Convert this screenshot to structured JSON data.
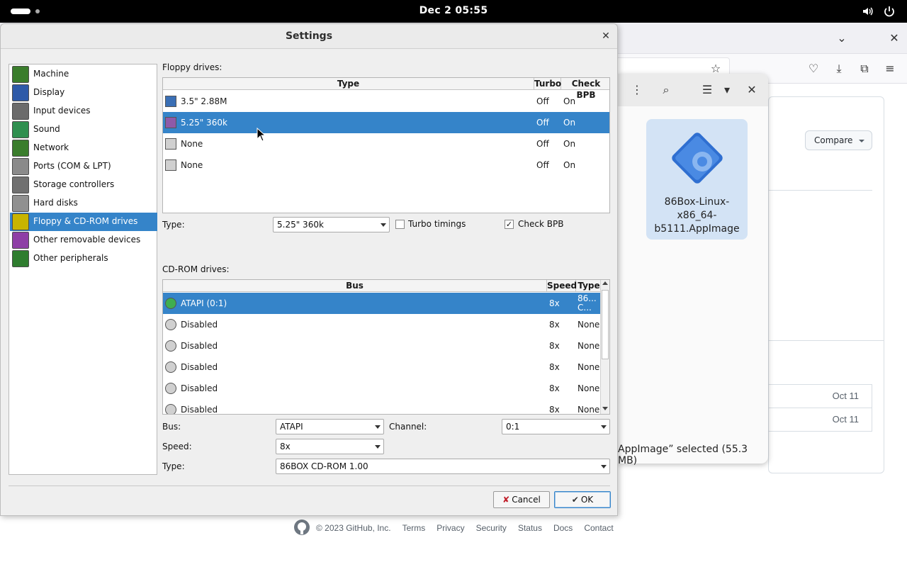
{
  "topbar": {
    "clock": "Dec 2  05:55"
  },
  "browser": {
    "compare_label": "Compare",
    "dates": [
      "Oct 11",
      "Oct 11"
    ],
    "footer": {
      "copyright": "© 2023 GitHub, Inc.",
      "links": [
        "Terms",
        "Privacy",
        "Security",
        "Status",
        "Docs",
        "Contact"
      ]
    }
  },
  "files": {
    "file_name_lines": [
      "86Box-Linux-",
      "x86_64-",
      "b5111.AppImage"
    ],
    "status": "AppImage” selected  (55.3 MB)"
  },
  "dialog": {
    "title": "Settings",
    "categories": [
      {
        "label": "Machine",
        "color": "#3a7d2c"
      },
      {
        "label": "Display",
        "color": "#2e5aa8"
      },
      {
        "label": "Input devices",
        "color": "#6b6b6b"
      },
      {
        "label": "Sound",
        "color": "#2f8f4f"
      },
      {
        "label": "Network",
        "color": "#3a7d2c"
      },
      {
        "label": "Ports (COM & LPT)",
        "color": "#8a8a8a"
      },
      {
        "label": "Storage controllers",
        "color": "#707070"
      },
      {
        "label": "Hard disks",
        "color": "#909090"
      },
      {
        "label": "Floppy & CD-ROM drives",
        "color": "#c8b400"
      },
      {
        "label": "Other removable devices",
        "color": "#8e3fa6"
      },
      {
        "label": "Other peripherals",
        "color": "#2f7d2f"
      }
    ],
    "selected_category": 8,
    "floppy": {
      "section_label": "Floppy drives:",
      "headers": {
        "type": "Type",
        "turbo": "Turbo",
        "check_bpb": "Check BPB"
      },
      "rows": [
        {
          "type": "3.5\" 2.88M",
          "turbo": "Off",
          "check_bpb": "On",
          "icon": "floppy-35-icon"
        },
        {
          "type": "5.25\" 360k",
          "turbo": "Off",
          "check_bpb": "On",
          "icon": "floppy-525-icon"
        },
        {
          "type": "None",
          "turbo": "Off",
          "check_bpb": "On",
          "icon": "floppy-none-icon"
        },
        {
          "type": "None",
          "turbo": "Off",
          "check_bpb": "On",
          "icon": "floppy-none-icon"
        }
      ],
      "selected_row": 1,
      "type_label": "Type:",
      "type_value": "5.25\" 360k",
      "turbo_label": "Turbo timings",
      "turbo_checked": false,
      "checkbpb_label": "Check BPB",
      "checkbpb_checked": true,
      "check_mark": "✓"
    },
    "cdrom": {
      "section_label": "CD-ROM drives:",
      "headers": {
        "bus": "Bus",
        "speed": "Speed",
        "type": "Type"
      },
      "rows": [
        {
          "bus": "ATAPI (0:1)",
          "speed": "8x",
          "type_line1": "86...",
          "type_line2": "C..."
        },
        {
          "bus": "Disabled",
          "speed": "8x",
          "type": "None"
        },
        {
          "bus": "Disabled",
          "speed": "8x",
          "type": "None"
        },
        {
          "bus": "Disabled",
          "speed": "8x",
          "type": "None"
        },
        {
          "bus": "Disabled",
          "speed": "8x",
          "type": "None"
        },
        {
          "bus": "Disabled",
          "speed": "8x",
          "type": "None"
        }
      ],
      "selected_row": 0,
      "bus_label": "Bus:",
      "bus_value": "ATAPI",
      "channel_label": "Channel:",
      "channel_value": "0:1",
      "speed_label": "Speed:",
      "speed_value": "8x",
      "type_label": "Type:",
      "type_value": "86BOX CD-ROM 1.00"
    },
    "buttons": {
      "cancel": "Cancel",
      "ok": "OK"
    }
  }
}
